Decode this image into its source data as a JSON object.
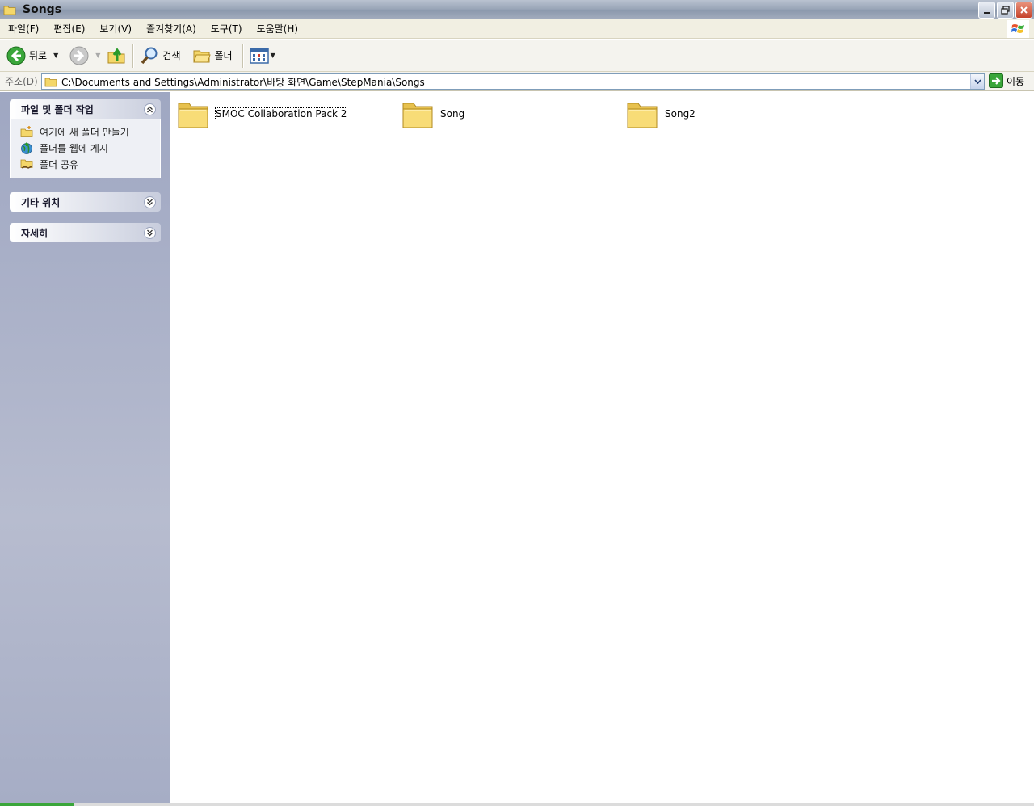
{
  "window": {
    "title": "Songs"
  },
  "menu": {
    "items": [
      "파일(F)",
      "편집(E)",
      "보기(V)",
      "즐겨찾기(A)",
      "도구(T)",
      "도움말(H)"
    ]
  },
  "toolbar": {
    "back_label": "뒤로",
    "search_label": "검색",
    "folders_label": "폴더"
  },
  "address": {
    "label": "주소(D)",
    "path": "C:\\Documents and Settings\\Administrator\\바탕 화면\\Game\\StepMania\\Songs",
    "go_label": "이동"
  },
  "taskpane": {
    "file_tasks": {
      "title": "파일 및 폴더 작업",
      "items": [
        "여기에 새 폴더 만들기",
        "폴더를 웹에 게시",
        "폴더 공유"
      ]
    },
    "other_places": {
      "title": "기타 위치"
    },
    "details": {
      "title": "자세히"
    }
  },
  "folders": [
    {
      "name": "SMOC Collaboration Pack 2",
      "selected": true
    },
    {
      "name": "Song",
      "selected": false
    },
    {
      "name": "Song2",
      "selected": false
    }
  ],
  "colors": {
    "folder_yellow": "#f4d76a",
    "taskpane_bg": "#a6adc5",
    "menubar_bg": "#f1efe2"
  }
}
